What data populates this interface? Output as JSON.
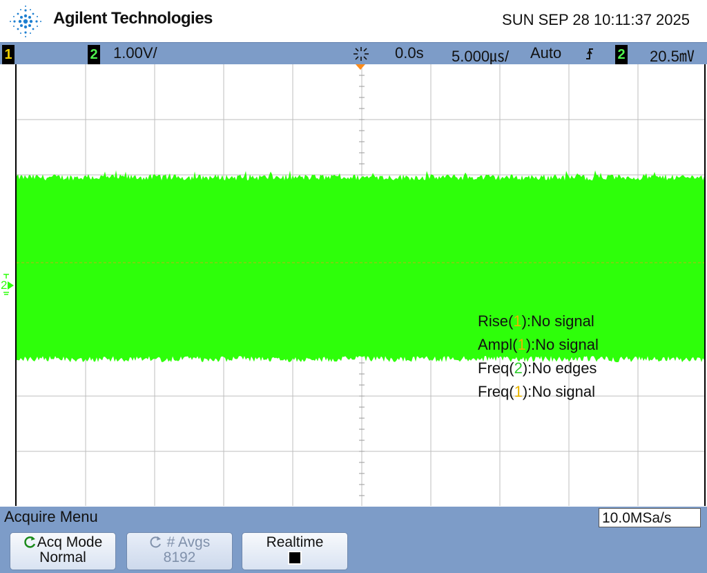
{
  "brand": "Agilent Technologies",
  "datetime": "SUN SEP 28 10:11:37 2025",
  "status": {
    "ch1_box": "1",
    "ch2_box": "2",
    "ch2_scale": "1.00V/",
    "time_offset": "0.0s",
    "time_scale": "5.000㎲/",
    "trigger_mode": "Auto",
    "trigger_slope_icon": "rising-edge",
    "trigger_source": "2",
    "trigger_level": "20.5㎷"
  },
  "channel_marker": "2",
  "measurements": [
    {
      "pre": "Rise(",
      "ch": "1",
      "post": "):No signal"
    },
    {
      "pre": "Ampl(",
      "ch": "1",
      "post": "):No signal"
    },
    {
      "pre": "Freq(",
      "ch": "2",
      "post": "):No edges"
    },
    {
      "pre": "Freq(",
      "ch": "1",
      "post": "):No signal"
    }
  ],
  "menu": {
    "title": "Acquire Menu",
    "sample_rate": "10.0MSa/s",
    "softkeys": {
      "acq_mode_label": "Acq Mode",
      "acq_mode_value": "Normal",
      "avgs_label": "# Avgs",
      "avgs_value": "8192",
      "realtime_label": "Realtime"
    }
  },
  "colors": {
    "trace": "#2eff0a",
    "ch1": "#f0d000",
    "ch2": "#4ff44f",
    "trigger_marker": "#ff8c1a",
    "panel": "#7d9cc8"
  }
}
